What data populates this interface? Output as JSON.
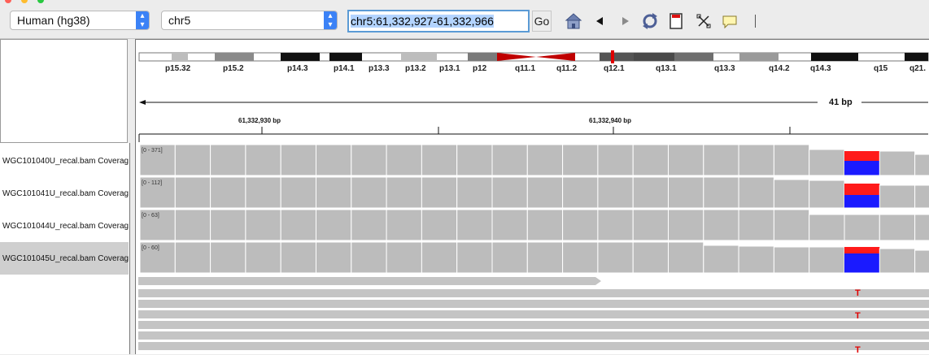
{
  "toolbar": {
    "genome": "Human (hg38)",
    "chromosome": "chr5",
    "locus": "chr5:61,332,927-61,332,966",
    "go_label": "Go",
    "icons": [
      "home-icon",
      "back-icon",
      "forward-icon",
      "refresh-icon",
      "roi-icon",
      "resize-icon",
      "popup-text-icon"
    ]
  },
  "ideogram": {
    "bands": [
      "p15.32",
      "p15.2",
      "p14.3",
      "p14.1",
      "p13.3",
      "p13.2",
      "p13.1",
      "p12",
      "q11.1",
      "q11.2",
      "q12.1",
      "q13.1",
      "q13.3",
      "q14.2",
      "q14.3",
      "q15",
      "q21."
    ]
  },
  "ruler": {
    "width_label": "41 bp",
    "tick_labels": [
      "61,332,930 bp",
      "61,332,940 bp"
    ]
  },
  "tracks": [
    {
      "name": "WGC101040U_recal.bam Coverage",
      "range": "[0 - 371]"
    },
    {
      "name": "WGC101041U_recal.bam Coverage",
      "range": "[0 - 112]"
    },
    {
      "name": "WGC101044U_recal.bam Coverage",
      "range": "[0 - 63]"
    },
    {
      "name": "WGC101045U_recal.bam Coverage",
      "range": "[0 - 60]"
    }
  ],
  "alignments": {
    "mismatch_base": "T"
  },
  "colors": {
    "coverage": "#bcbcbc",
    "allele_a": "#ff1a1a",
    "allele_b": "#1a1aff",
    "mismatch": "#e00000",
    "centromere": "#c00000"
  }
}
